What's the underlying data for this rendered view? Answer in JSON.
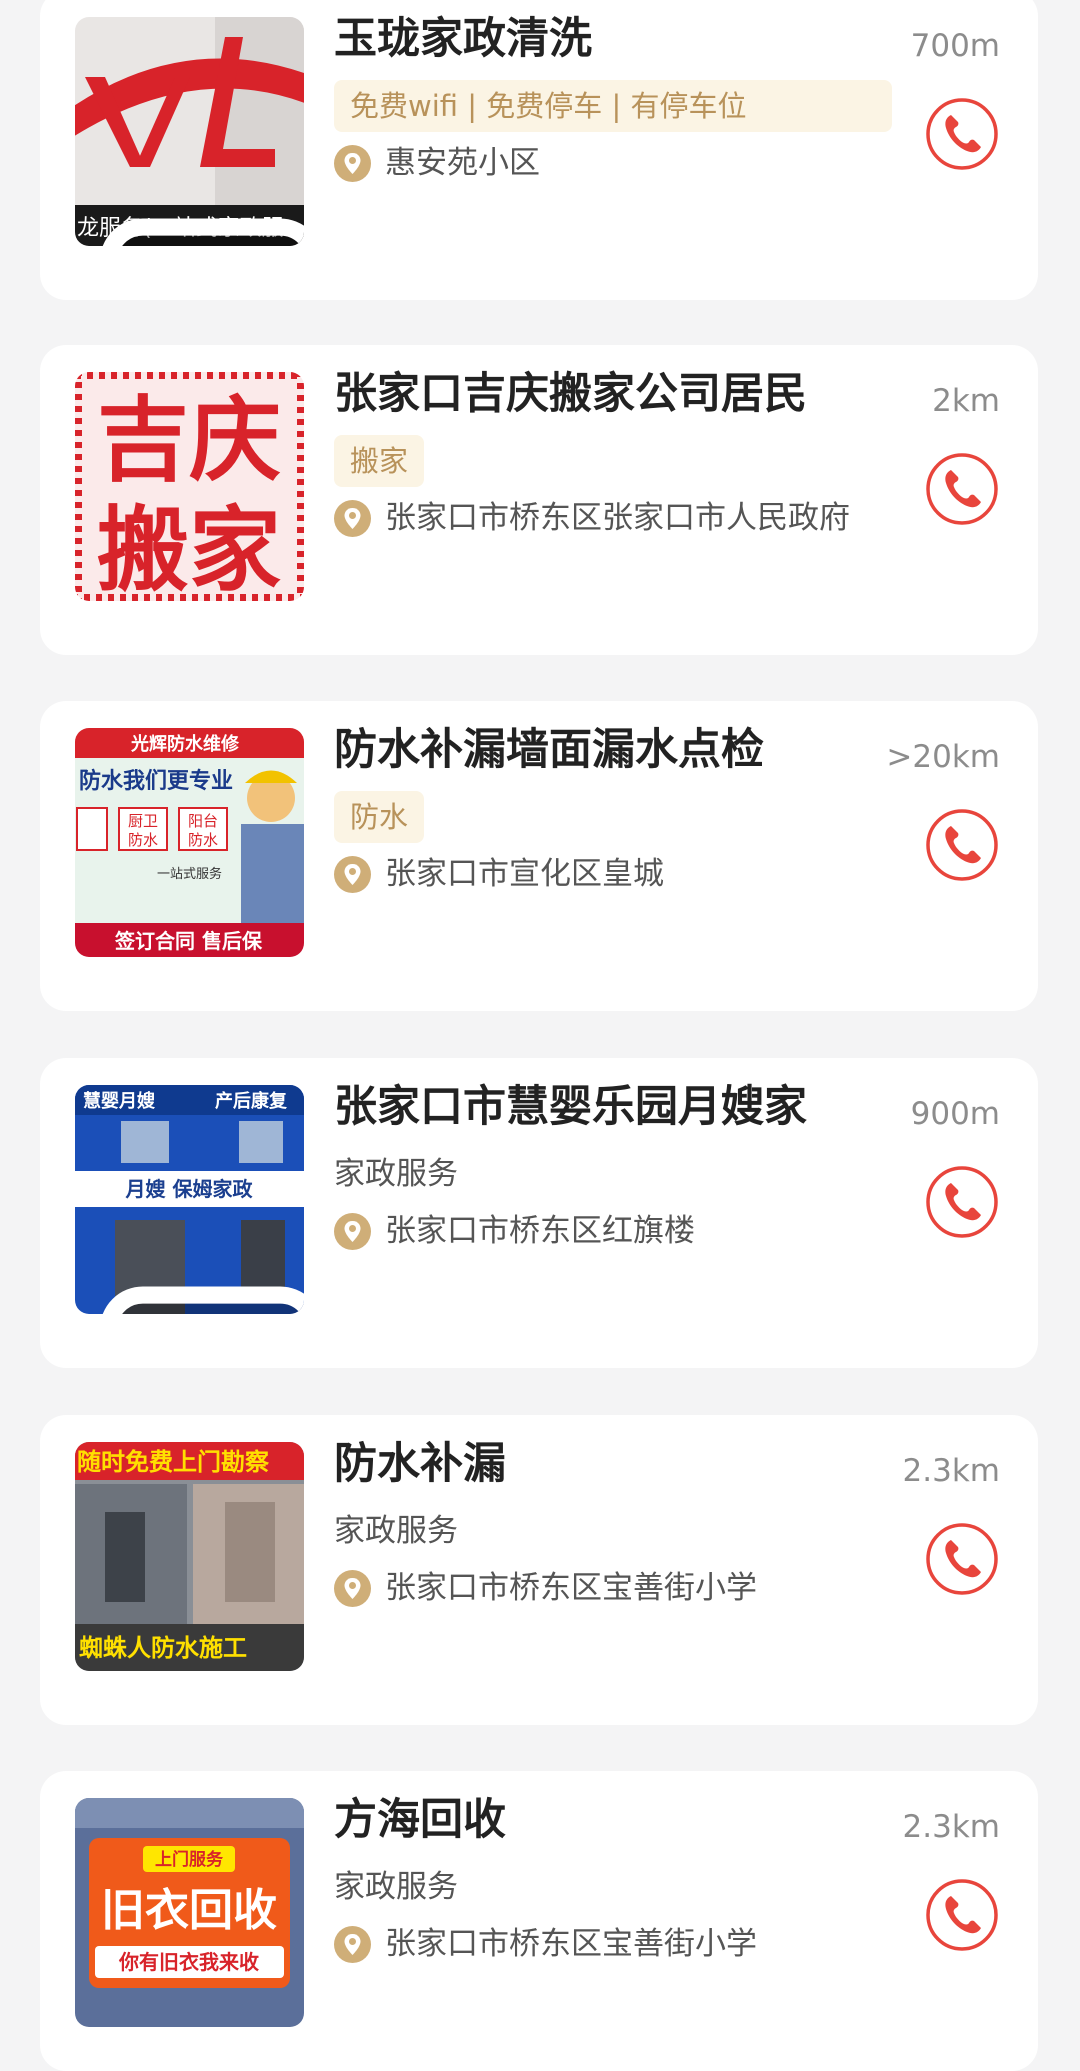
{
  "colors": {
    "accent_red": "#e8453c",
    "tag_bg": "#fbf4e4",
    "tag_text": "#b8925a",
    "pin": "#cfae78"
  },
  "listings": [
    {
      "name": "玉珑家政清洗",
      "distance": "700m",
      "tags": "免费wifi | 免费停车 | 有停车位",
      "address": "惠安苑小区",
      "thumb_text": "龙服务(一站式家政服",
      "has_video": true
    },
    {
      "name": "张家口吉庆搬家公司居民",
      "distance": "2km",
      "tags": "搬家",
      "address": "张家口市桥东区张家口市人民政府",
      "thumb_text_1": "吉庆",
      "thumb_text_2": "搬家"
    },
    {
      "name": "防水补漏墙面漏水点检",
      "distance": ">20km",
      "tags": "防水",
      "address": "张家口市宣化区皇城",
      "thumb_title": "光辉防水维修",
      "thumb_slogan": "防水我们更专业",
      "thumb_items": [
        "厨卫",
        "阳台",
        "防水",
        "防水"
      ],
      "thumb_service": "一站式服务",
      "thumb_bottom": "签订合同 售后保"
    },
    {
      "name": "张家口市慧婴乐园月嫂家",
      "distance": "900m",
      "category": "家政服务",
      "address": "张家口市桥东区红旗楼",
      "thumb_left": "慧婴月嫂",
      "thumb_right": "产后康复",
      "thumb_sign": "月嫂 保姆家政",
      "has_video": true
    },
    {
      "name": "防水补漏",
      "distance": "2.3km",
      "category": "家政服务",
      "address": "张家口市桥东区宝善街小学",
      "thumb_top": "随时免费上门勘察",
      "thumb_bottom": "蜘蛛人防水施工"
    },
    {
      "name": "方海回收",
      "distance": "2.3km",
      "category": "家政服务",
      "address": "张家口市桥东区宝善街小学",
      "thumb_top": "上门服务",
      "thumb_main": "旧衣回收",
      "thumb_bottom": "你有旧衣我来收"
    }
  ]
}
